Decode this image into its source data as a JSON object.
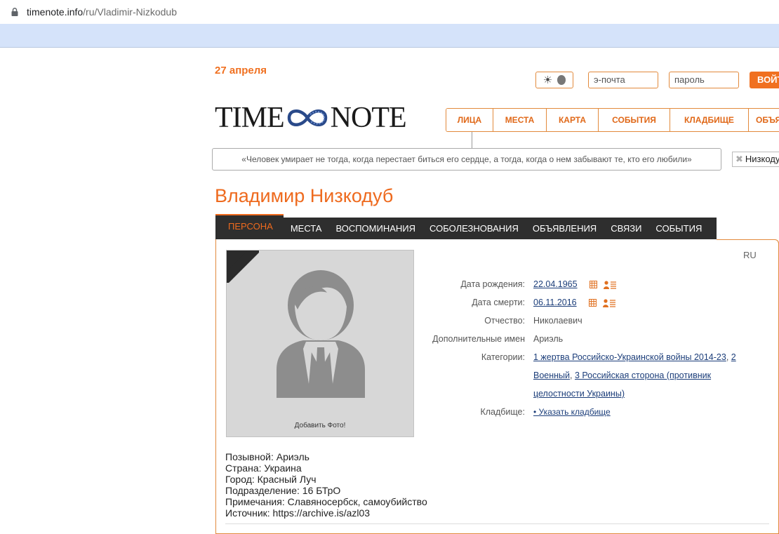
{
  "browser": {
    "url_host": "timenote.info",
    "url_path": "/ru/Vladimir-Nizkodub"
  },
  "header": {
    "date": "27 апреля",
    "email_placeholder": "э-почта",
    "password_placeholder": "пароль",
    "login_label": "ВОЙТИ",
    "logo_left": "TIME",
    "logo_right": "NOTE"
  },
  "main_nav": {
    "items": [
      {
        "label": "ЛИЦА"
      },
      {
        "label": "МЕСТА"
      },
      {
        "label": "КАРТА"
      },
      {
        "label": "СОБЫТИЯ"
      },
      {
        "label": "КЛАДБИЩЕ"
      },
      {
        "label": "ОБЪЯВЛЕНИЯ"
      }
    ]
  },
  "quote": "«Человек умирает не тогда, когда перестает биться его сердце, а тогда, когда о нем забывают те, кто его любили»",
  "search_chip": "Низкодуб",
  "person": {
    "name": "Владимир Низкодуб",
    "lang": "RU",
    "add_photo": "Добавить Фото!"
  },
  "tabs": [
    {
      "label": "ПЕРСОНА"
    },
    {
      "label": "МЕСТА"
    },
    {
      "label": "ВОСПОМИНАНИЯ"
    },
    {
      "label": "СОБОЛЕЗНОВАНИЯ"
    },
    {
      "label": "ОБЪЯВЛЕНИЯ"
    },
    {
      "label": "СВЯЗИ"
    },
    {
      "label": "СОБЫТИЯ"
    }
  ],
  "info": {
    "birth_label": "Дата рождения:",
    "birth_value": "22.04.1965",
    "death_label": "Дата смерти:",
    "death_value": "06.11.2016",
    "patronymic_label": "Отчество:",
    "patronymic_value": "Николаевич",
    "extra_names_label": "Дополнительные имен",
    "extra_names_value": "Ариэль",
    "categories_label": "Категории:",
    "cat1_link": "1 жертва Российско-Украинской войны 2014-23",
    "cat2_link": "2 Военный",
    "cat3_link": "3 Российская сторона (противник целостности Украины)",
    "cemetery_label": "Кладбище:",
    "cemetery_link": "• Указать кладбище"
  },
  "details": [
    "Позывной: Ариэль",
    "Страна: Украина",
    "Город: Красный Луч",
    "Подразделение: 16 БТрО",
    "Примечания: Славяносербск, самоубийство",
    "Источник: https://archive.is/azl03"
  ],
  "colors": {
    "accent": "#f07020",
    "tabbar": "#2e2e2e",
    "link": "#1c3e7a",
    "bookmark_bar": "#d5e3fa"
  }
}
